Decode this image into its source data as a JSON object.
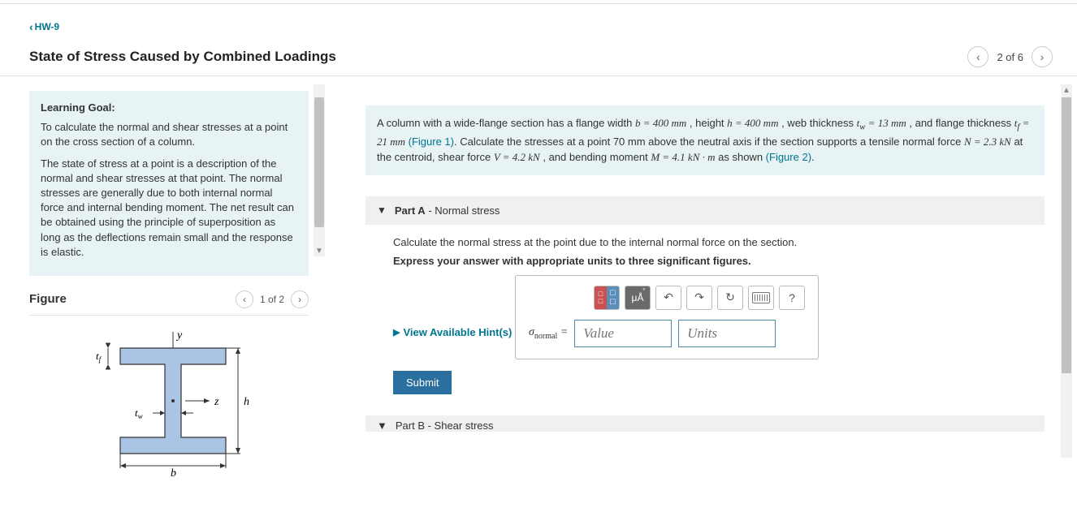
{
  "nav": {
    "back_label": "HW-9"
  },
  "title": "State of Stress Caused by Combined Loadings",
  "top_pager": {
    "text": "2 of 6"
  },
  "learning_goal": {
    "heading": "Learning Goal:",
    "p1": "To calculate the normal and shear stresses at a point on the cross section of a column.",
    "p2": "The state of stress at a point is a description of the normal and shear stresses at that point. The normal stresses are generally due to both internal normal force and internal bending moment. The net result can be obtained using the principle of superposition as long as the deflections remain small and the response is elastic."
  },
  "figure": {
    "heading": "Figure",
    "pager_text": "1 of 2"
  },
  "problem": {
    "t1": "A column with a wide-flange section has a flange width ",
    "v_b": "b = 400 mm",
    "t2": " , height ",
    "v_h": "h = 400 mm",
    "t3": " , web thickness ",
    "v_tw_sym": "t",
    "v_tw_sub": "w",
    "v_tw_val": " = 13 mm",
    "t4": " , and flange thickness ",
    "v_tf_sym": "t",
    "v_tf_sub": "f",
    "v_tf_val": " = 21 mm",
    "fig1": " (Figure 1)",
    "t5": ". Calculate the stresses at a point 70 mm above the neutral axis if the section supports a tensile normal force ",
    "v_N": "N = 2.3 kN",
    "t6": " at the centroid, shear force ",
    "v_V": "V = 4.2 kN",
    "t7": " , and bending moment ",
    "v_M": "M = 4.1 kN · m",
    "t8": " as shown ",
    "fig2": "(Figure 2)",
    "t9": "."
  },
  "partA": {
    "label_prefix": "Part A",
    "label_suffix": " - Normal stress",
    "question": "Calculate the normal stress at the point due to the internal normal force on the section.",
    "instruction": "Express your answer with appropriate units to three significant figures.",
    "hints_label": "View Available Hint(s)",
    "sigma_sym": "σ",
    "sigma_sub": "normal",
    "equals": " =",
    "value_placeholder": "Value",
    "units_placeholder": "Units",
    "submit_label": "Submit",
    "toolbar": {
      "ua": "μÅ",
      "undo": "↶",
      "redo": "↷",
      "reset": "↻",
      "help": "?"
    }
  },
  "partB": {
    "label_prefix": "Part B",
    "label_suffix": " - Shear stress"
  },
  "chart_data": {
    "type": "diagram",
    "description": "Wide-flange (I-beam) cross section",
    "labels": [
      "y",
      "z",
      "h",
      "b",
      "t_f",
      "t_w"
    ],
    "parameters": {
      "b_mm": 400,
      "h_mm": 400,
      "tw_mm": 13,
      "tf_mm": 21
    }
  }
}
